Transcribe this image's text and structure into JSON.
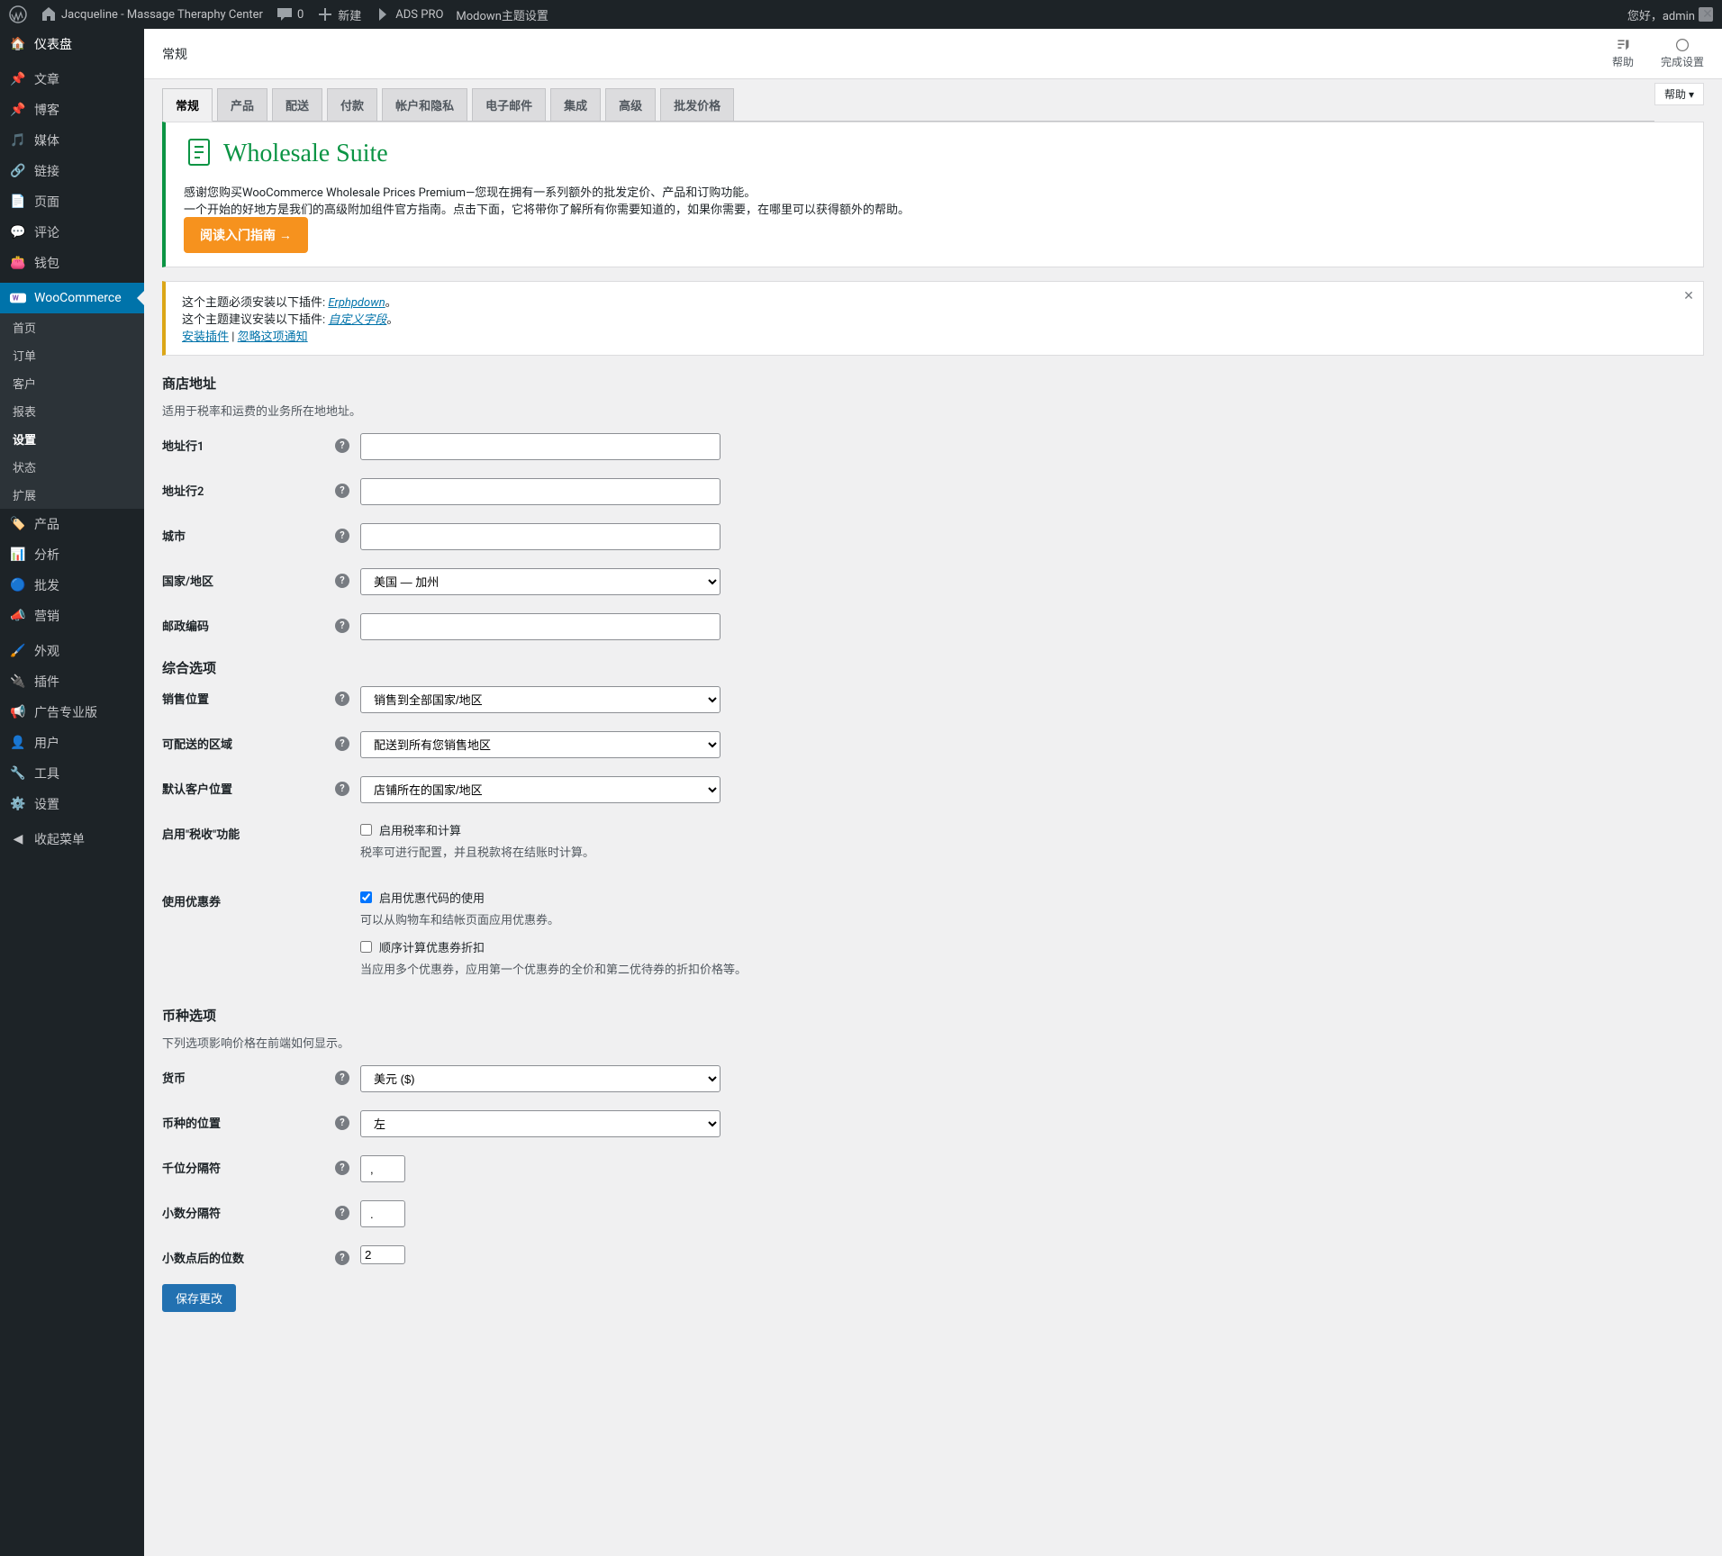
{
  "adminbar": {
    "site_name": "Jacqueline - Massage Theraphy Center",
    "comment_count": "0",
    "new": "新建",
    "ads": "ADS PRO",
    "modown": "Modown主题设置",
    "greeting": "您好，admin"
  },
  "sidebar": {
    "dashboard": "仪表盘",
    "posts": "文章",
    "blog": "博客",
    "media": "媒体",
    "links": "链接",
    "pages": "页面",
    "comments": "评论",
    "wallet": "钱包",
    "woocommerce": "WooCommerce",
    "wc": {
      "home": "首页",
      "orders": "订单",
      "customers": "客户",
      "reports": "报表",
      "settings": "设置",
      "status": "状态",
      "extensions": "扩展"
    },
    "products": "产品",
    "analytics": "分析",
    "wholesale": "批发",
    "marketing": "营销",
    "appearance": "外观",
    "plugins": "插件",
    "ads_pro": "广告专业版",
    "users": "用户",
    "tools": "工具",
    "settings_menu": "设置",
    "collapse": "收起菜单"
  },
  "header": {
    "title": "常规",
    "help": "帮助",
    "finish": "完成设置",
    "help_tab": "帮助 ▾"
  },
  "tabs": {
    "general": "常规",
    "products": "产品",
    "shipping": "配送",
    "payments": "付款",
    "accounts": "帐户和隐私",
    "emails": "电子邮件",
    "integration": "集成",
    "advanced": "高级",
    "wholesale": "批发价格"
  },
  "notice_ws": {
    "title": "Wholesale Suite",
    "p1": "感谢您购买WooCommerce Wholesale Prices Premium—您现在拥有一系列额外的批发定价、产品和订购功能。",
    "p2": "一个开始的好地方是我们的高级附加组件官方指南。点击下面，它将带你了解所有你需要知道的，如果你需要，在哪里可以获得额外的帮助。",
    "btn": "阅读入门指南 →"
  },
  "notice_plugin": {
    "t1a": "这个主题必须安装以下插件: ",
    "t1b": "Erphpdown",
    "t1c": "。",
    "t2a": "这个主题建议安装以下插件: ",
    "t2b": "自定义字段",
    "t2c": "。",
    "install": "安装插件",
    "dismiss": "忽略这项通知"
  },
  "form": {
    "store_address": "商店地址",
    "store_desc": "适用于税率和运费的业务所在地地址。",
    "address1": "地址行1",
    "address2": "地址行2",
    "city": "城市",
    "country": "国家/地区",
    "country_val": "美国 — 加州",
    "postcode": "邮政编码",
    "general_options": "综合选项",
    "selling_loc": "销售位置",
    "selling_val": "销售到全部国家/地区",
    "shipping_loc": "可配送的区域",
    "shipping_val": "配送到所有您销售地区",
    "default_cust": "默认客户位置",
    "default_cust_val": "店铺所在的国家/地区",
    "enable_tax": "启用\"税收\"功能",
    "enable_tax_cb": "启用税率和计算",
    "enable_tax_desc": "税率可进行配置，并且税款将在结账时计算。",
    "coupons": "使用优惠券",
    "coupons_cb1": "启用优惠代码的使用",
    "coupons_desc1": "可以从购物车和结帐页面应用优惠券。",
    "coupons_cb2": "顺序计算优惠券折扣",
    "coupons_desc2": "当应用多个优惠券，应用第一个优惠券的全价和第二优待券的折扣价格等。",
    "currency_opts": "币种选项",
    "currency_desc": "下列选项影响价格在前端如何显示。",
    "currency": "货币",
    "currency_val": "美元 ($)",
    "currency_pos": "币种的位置",
    "currency_pos_val": "左",
    "thousand_sep": "千位分隔符",
    "thousand_sep_val": ",",
    "decimal_sep": "小数分隔符",
    "decimal_sep_val": ".",
    "decimals": "小数点后的位数",
    "decimals_val": "2",
    "save": "保存更改"
  }
}
